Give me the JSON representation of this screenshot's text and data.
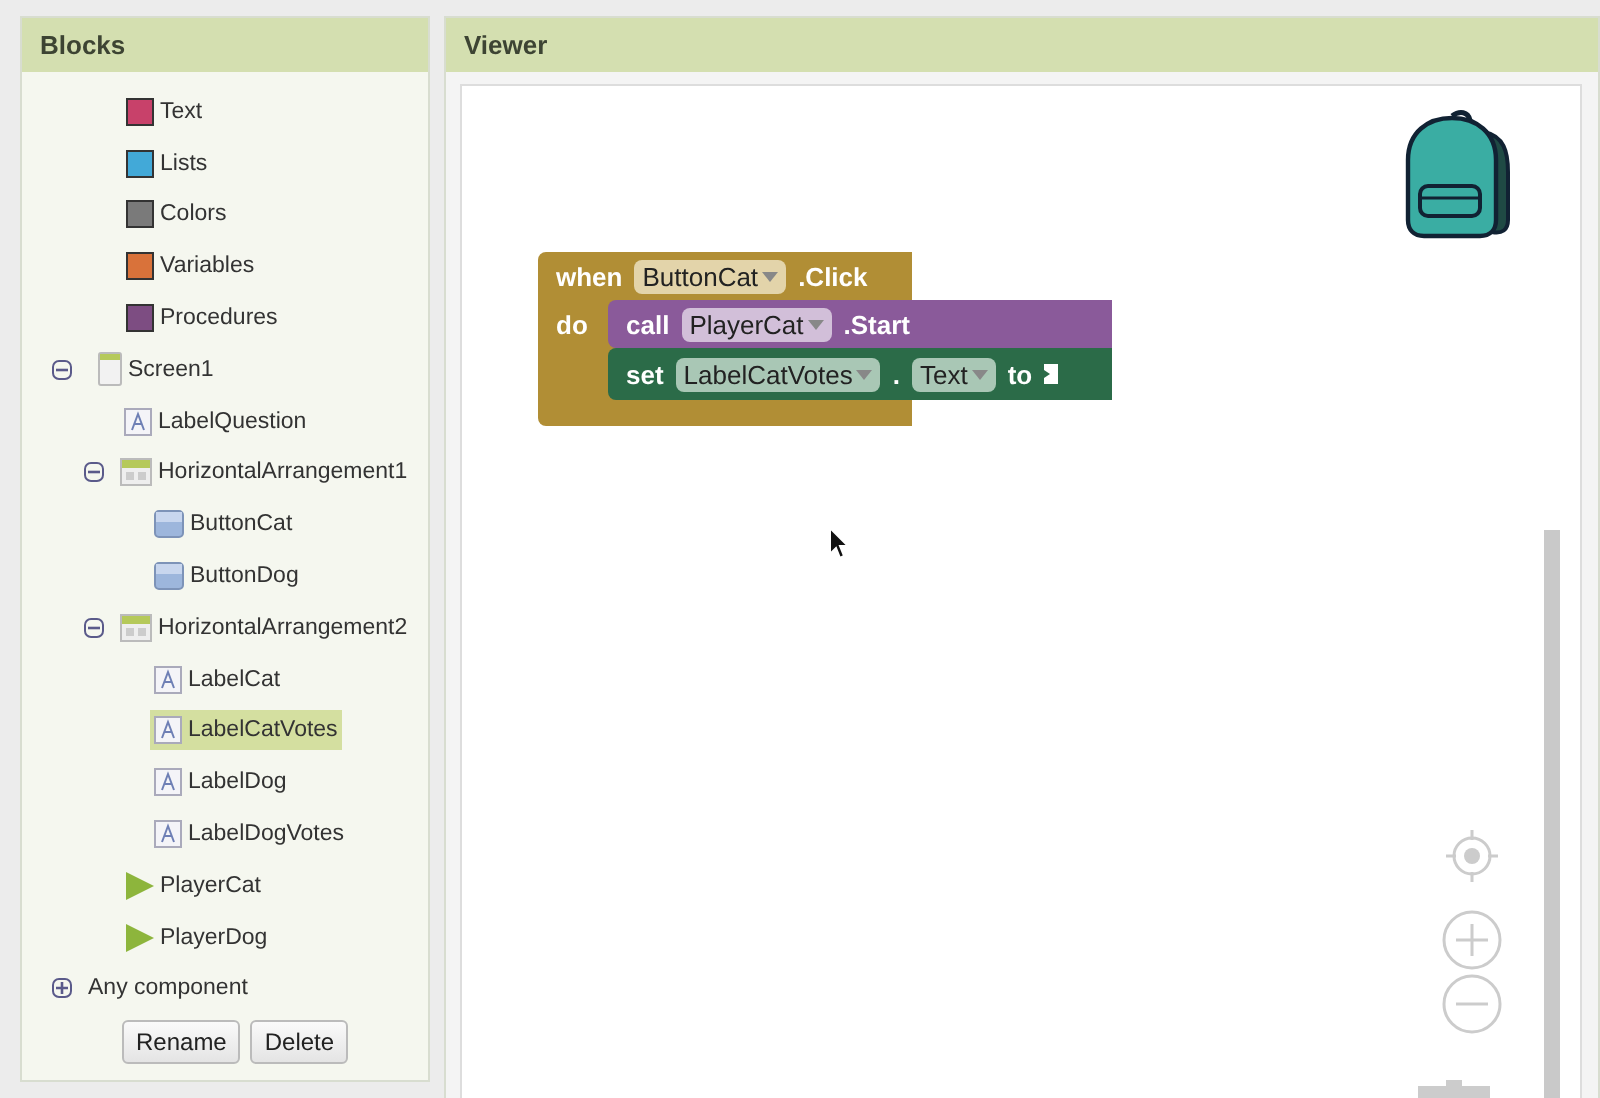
{
  "blocks_panel": {
    "title": "Blocks",
    "categories": [
      {
        "label": "Text",
        "color": "#c8416a"
      },
      {
        "label": "Lists",
        "color": "#42a9d8"
      },
      {
        "label": "Colors",
        "color": "#7a7a7a"
      },
      {
        "label": "Variables",
        "color": "#d9723a"
      },
      {
        "label": "Procedures",
        "color": "#7d4d82"
      }
    ],
    "tree": [
      {
        "label": "Screen1",
        "kind": "screen",
        "expanded": true,
        "selected": false,
        "children": [
          {
            "label": "LabelQuestion",
            "kind": "label",
            "selected": false
          },
          {
            "label": "HorizontalArrangement1",
            "kind": "arrangement",
            "expanded": true,
            "selected": false,
            "children": [
              {
                "label": "ButtonCat",
                "kind": "button",
                "selected": false
              },
              {
                "label": "ButtonDog",
                "kind": "button",
                "selected": false
              }
            ]
          },
          {
            "label": "HorizontalArrangement2",
            "kind": "arrangement",
            "expanded": true,
            "selected": false,
            "children": [
              {
                "label": "LabelCat",
                "kind": "label",
                "selected": false
              },
              {
                "label": "LabelCatVotes",
                "kind": "label",
                "selected": true
              },
              {
                "label": "LabelDog",
                "kind": "label",
                "selected": false
              },
              {
                "label": "LabelDogVotes",
                "kind": "label",
                "selected": false
              }
            ]
          },
          {
            "label": "PlayerCat",
            "kind": "player",
            "selected": false
          },
          {
            "label": "PlayerDog",
            "kind": "player",
            "selected": false
          }
        ]
      },
      {
        "label": "Any component",
        "kind": "group",
        "expanded": false,
        "selected": false
      }
    ],
    "buttons": [
      "Rename",
      "Delete"
    ]
  },
  "viewer": {
    "title": "Viewer",
    "event_block": {
      "keyword": "when",
      "component": "ButtonCat",
      "event": ".Click",
      "do": "do",
      "statements": [
        {
          "kind": "call",
          "keyword": "call",
          "component": "PlayerCat",
          "member": ".Start"
        },
        {
          "kind": "set",
          "keyword": "set",
          "component": "LabelCatVotes",
          "dot": ".",
          "property": "Text",
          "to": "to"
        }
      ]
    }
  }
}
